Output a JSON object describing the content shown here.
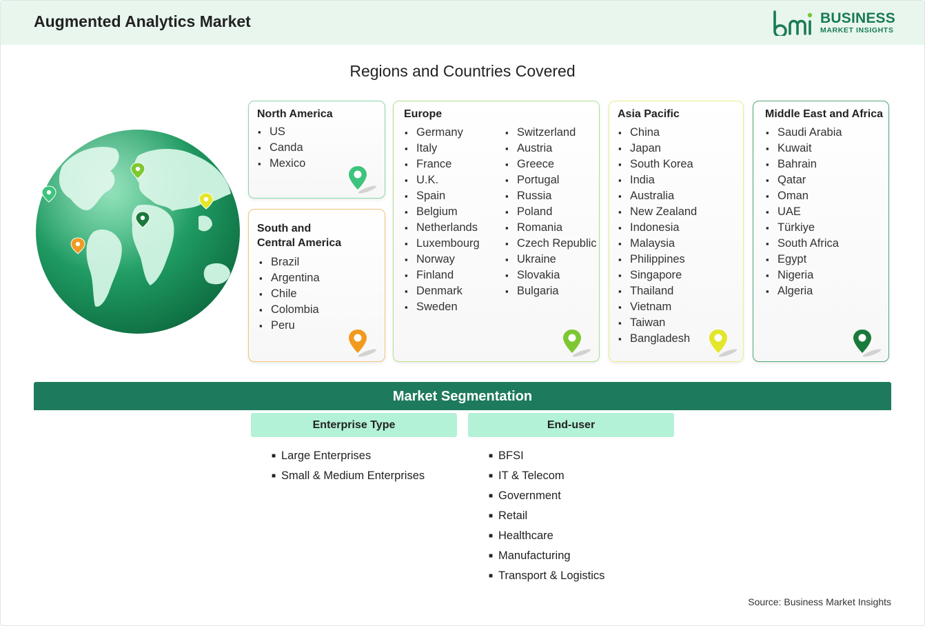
{
  "header": {
    "title": "Augmented Analytics Market"
  },
  "logo": {
    "word1": "BUSINESS",
    "word2": "MARKET INSIGHTS",
    "brand_color": "#1a7a55"
  },
  "regions": {
    "title": "Regions and Countries Covered",
    "north_america": {
      "title": "North America",
      "items": [
        "US",
        "Canda",
        "Mexico"
      ],
      "pin_color": "#3cc47c"
    },
    "south_central_america": {
      "title_line1": "South and",
      "title_line2": "Central America",
      "items": [
        "Brazil",
        "Argentina",
        "Chile",
        "Colombia",
        "Peru"
      ],
      "pin_color": "#f29a1e"
    },
    "europe": {
      "title": "Europe",
      "col1": [
        "Germany",
        "Italy",
        "France",
        "U.K.",
        "Spain",
        "Belgium",
        "Netherlands",
        "Luxembourg",
        "Norway",
        "Finland",
        "Denmark",
        "Sweden"
      ],
      "col2": [
        "Switzerland",
        "Austria",
        "Greece",
        "Portugal",
        "Russia",
        "Poland",
        "Romania",
        "Czech Republic",
        "Ukraine",
        "Slovakia",
        "Bulgaria"
      ],
      "pin_color": "#7dc832"
    },
    "asia_pacific": {
      "title": "Asia Pacific",
      "items": [
        "China",
        "Japan",
        "South Korea",
        "India",
        "Australia",
        "New Zealand",
        "Indonesia",
        "Malaysia",
        "Philippines",
        "Singapore",
        "Thailand",
        "Vietnam",
        "Taiwan",
        "Bangladesh"
      ],
      "pin_color": "#e3e62a"
    },
    "middle_east_africa": {
      "title": "Middle East and Africa",
      "items": [
        "Saudi Arabia",
        "Kuwait",
        "Bahrain",
        "Qatar",
        "Oman",
        "UAE",
        "Türkiye",
        "South Africa",
        "Egypt",
        "Nigeria",
        "Algeria"
      ],
      "pin_color": "#1a7a3c"
    }
  },
  "segmentation": {
    "title": "Market Segmentation",
    "enterprise_type": {
      "label": "Enterprise Type",
      "items": [
        "Large Enterprises",
        "Small & Medium Enterprises"
      ]
    },
    "end_user": {
      "label": "End-user",
      "items": [
        "BFSI",
        "IT & Telecom",
        "Government",
        "Retail",
        "Healthcare",
        "Manufacturing",
        "Transport & Logistics"
      ]
    }
  },
  "source": "Source: Business Market Insights"
}
